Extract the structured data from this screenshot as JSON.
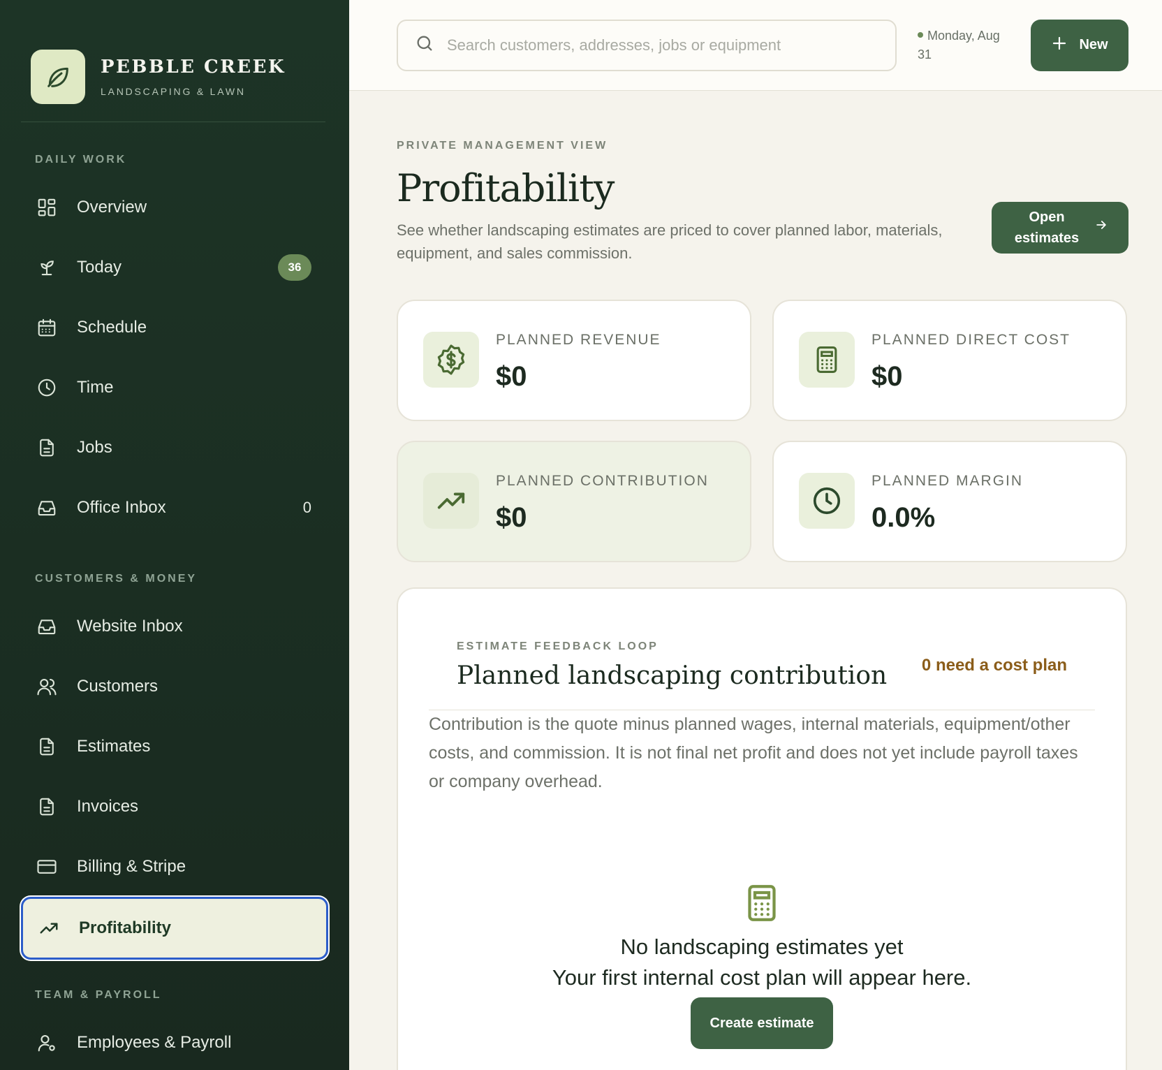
{
  "brand": {
    "name": "PEBBLE CREEK",
    "subtitle": "LANDSCAPING & LAWN"
  },
  "sidebar": {
    "sections": {
      "daily_work": "DAILY WORK",
      "customers_money": "CUSTOMERS & MONEY",
      "team_payroll": "TEAM & PAYROLL"
    },
    "items": {
      "overview": "Overview",
      "today": "Today",
      "today_badge": "36",
      "schedule": "Schedule",
      "time": "Time",
      "jobs": "Jobs",
      "office_inbox": "Office Inbox",
      "office_inbox_count": "0",
      "website_inbox": "Website Inbox",
      "customers": "Customers",
      "estimates": "Estimates",
      "invoices": "Invoices",
      "billing": "Billing & Stripe",
      "profitability": "Profitability",
      "employees": "Employees & Payroll"
    }
  },
  "topbar": {
    "search_placeholder": "Search customers, addresses, jobs or equipment",
    "date": "Monday, Aug 31",
    "new_label": "New"
  },
  "page": {
    "eyebrow": "PRIVATE MANAGEMENT VIEW",
    "title": "Profitability",
    "description": "See whether landscaping estimates are priced to cover planned labor, materials, equipment, and sales commission.",
    "open_estimates_label": "Open estimates"
  },
  "stats": [
    {
      "label": "PLANNED REVENUE",
      "value": "$0",
      "icon": "dollar-badge-icon"
    },
    {
      "label": "PLANNED DIRECT COST",
      "value": "$0",
      "icon": "calculator-icon"
    },
    {
      "label": "PLANNED CONTRIBUTION",
      "value": "$0",
      "icon": "trending-up-icon"
    },
    {
      "label": "PLANNED MARGIN",
      "value": "0.0%",
      "icon": "clock-icon"
    }
  ],
  "panel": {
    "eyebrow": "ESTIMATE FEEDBACK LOOP",
    "title": "Planned landscaping contribution",
    "flag": "0 need a cost plan",
    "description": "Contribution is the quote minus planned wages, internal materials, equipment/other costs, and commission. It is not final net profit and does not yet include payroll taxes or company overhead.",
    "empty_title": "No landscaping estimates yet",
    "empty_sub": "Your first internal cost plan will appear here.",
    "create_label": "Create estimate"
  },
  "colors": {
    "sidebar_bg": "#1d3426",
    "accent": "#3e6244",
    "badge": "#6b8a58",
    "flag": "#8b5d1a",
    "active_outline": "#2c5dc9"
  }
}
